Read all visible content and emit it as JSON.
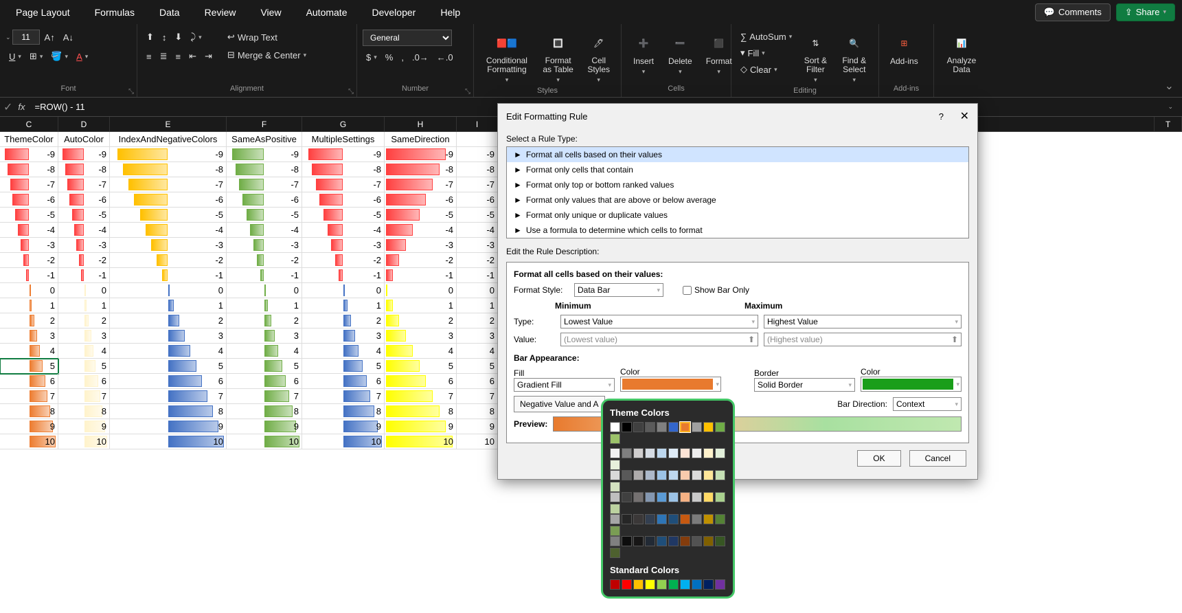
{
  "menu": {
    "items": [
      "Page Layout",
      "Formulas",
      "Data",
      "Review",
      "View",
      "Automate",
      "Developer",
      "Help"
    ],
    "comments": "Comments",
    "share": "Share"
  },
  "ribbon": {
    "font": {
      "label": "Font",
      "size": "11"
    },
    "alignment": {
      "label": "Alignment",
      "wrap": "Wrap Text",
      "merge": "Merge & Center"
    },
    "number": {
      "label": "Number",
      "format": "General"
    },
    "styles": {
      "label": "Styles",
      "conditional": "Conditional Formatting",
      "formatTable": "Format as Table",
      "cellStyles": "Cell Styles"
    },
    "cells": {
      "label": "Cells",
      "insert": "Insert",
      "delete": "Delete",
      "format": "Format"
    },
    "editing": {
      "label": "Editing",
      "autosum": "AutoSum",
      "fill": "Fill",
      "clear": "Clear",
      "sort": "Sort & Filter",
      "find": "Find & Select"
    },
    "addins": {
      "label": "Add-ins",
      "addins": "Add-ins"
    },
    "analyze": {
      "label": "",
      "analyze": "Analyze Data"
    }
  },
  "formula": {
    "fx": "fx",
    "value": "=ROW() - 11"
  },
  "grid": {
    "columns": [
      "C",
      "D",
      "E",
      "F",
      "G",
      "H",
      "I",
      "T"
    ],
    "headers": [
      "ThemeColor",
      "AutoColor",
      "IndexAndNegativeColors",
      "SameAsPositive",
      "MultipleSettings",
      "SameDirection",
      ""
    ],
    "values": [
      -9,
      -8,
      -7,
      -6,
      -5,
      -4,
      -3,
      -2,
      -1,
      0,
      1,
      2,
      3,
      4,
      5,
      6,
      7,
      8,
      9,
      10
    ],
    "selected_cell": "C5",
    "selected_value": 5
  },
  "dialog": {
    "title": "Edit Formatting Rule",
    "selectRuleLabel": "Select a Rule Type:",
    "rules": [
      "Format all cells based on their values",
      "Format only cells that contain",
      "Format only top or bottom ranked values",
      "Format only values that are above or below average",
      "Format only unique or duplicate values",
      "Use a formula to determine which cells to format"
    ],
    "editDescLabel": "Edit the Rule Description:",
    "formatHeader": "Format all cells based on their values:",
    "formatStyleLabel": "Format Style:",
    "formatStyle": "Data Bar",
    "showBarOnly": "Show Bar Only",
    "minimumLabel": "Minimum",
    "maximumLabel": "Maximum",
    "typeLabel": "Type:",
    "minType": "Lowest Value",
    "maxType": "Highest Value",
    "valueLabel": "Value:",
    "minValue": "(Lowest value)",
    "maxValue": "(Highest value)",
    "barAppearance": "Bar Appearance:",
    "fillLabel": "Fill",
    "fillValue": "Gradient Fill",
    "colorLabel": "Color",
    "fillColor": "#e87a2e",
    "borderLabel": "Border",
    "borderValue": "Solid Border",
    "borderColorLabel": "Color",
    "borderColor": "#1a9e1a",
    "negativeBtn": "Negative Value and A",
    "barDirLabel": "Bar Direction:",
    "barDirValue": "Context",
    "previewLabel": "Preview:",
    "ok": "OK",
    "cancel": "Cancel"
  },
  "colorPicker": {
    "themeTitle": "Theme Colors",
    "standardTitle": "Standard Colors",
    "themeColors": [
      [
        "#ffffff",
        "#000000",
        "#404040",
        "#5b5b5b",
        "#808080",
        "#3366cc",
        "#e87a2e",
        "#a0a0a0",
        "#ffc000",
        "#70ad47",
        "#9cc26a"
      ],
      [
        "#f2f2f2",
        "#7f7f7f",
        "#d0cece",
        "#d6dce4",
        "#bdd7ee",
        "#deebf6",
        "#fce4d6",
        "#ededed",
        "#fff2cc",
        "#e2efda",
        "#e7f0db"
      ],
      [
        "#d9d9d9",
        "#595959",
        "#aeabab",
        "#adb9ca",
        "#9cc3e6",
        "#bdd7ee",
        "#f8cbad",
        "#dbdbdb",
        "#ffe699",
        "#c5e0b4",
        "#d4e2c0"
      ],
      [
        "#bfbfbf",
        "#404040",
        "#757171",
        "#8497b0",
        "#5b9bd5",
        "#9cc3e6",
        "#f4b184",
        "#c9c9c9",
        "#ffd966",
        "#a9d18e",
        "#bcd2a0"
      ],
      [
        "#a6a6a6",
        "#262626",
        "#3b3838",
        "#333f50",
        "#2e75b6",
        "#1f4e79",
        "#c65911",
        "#7b7b7b",
        "#bf9000",
        "#548235",
        "#7a9d54"
      ],
      [
        "#808080",
        "#0d0d0d",
        "#171616",
        "#222a35",
        "#1f4e79",
        "#203864",
        "#843c0c",
        "#525252",
        "#806000",
        "#375623",
        "#4e612f"
      ]
    ],
    "standardColors": [
      "#c00000",
      "#ff0000",
      "#ffc000",
      "#ffff00",
      "#92d050",
      "#00b050",
      "#00b0f0",
      "#0070c0",
      "#002060",
      "#7030a0"
    ],
    "selected": "#e87a2e"
  },
  "chart_data": {
    "type": "table",
    "note": "Each column contains the same numeric series -9..10 rendered as conditional-format data bars with different color schemes.",
    "series_values": [
      -9,
      -8,
      -7,
      -6,
      -5,
      -4,
      -3,
      -2,
      -1,
      0,
      1,
      2,
      3,
      4,
      5,
      6,
      7,
      8,
      9,
      10
    ],
    "columns": [
      {
        "name": "ThemeColor",
        "negative_color": "#ff4040",
        "positive_color": "#ed7d31"
      },
      {
        "name": "AutoColor",
        "negative_color": "#ff4040",
        "positive_color": "#fff3cc"
      },
      {
        "name": "IndexAndNegativeColors",
        "negative_color": "#ffc000",
        "positive_color": "#4472c4"
      },
      {
        "name": "SameAsPositive",
        "negative_color": "#70ad47",
        "positive_color": "#70ad47"
      },
      {
        "name": "MultipleSettings",
        "negative_color": "#ff4040",
        "positive_color": "#4472c4"
      },
      {
        "name": "SameDirection",
        "negative_color": "#ff4040",
        "positive_color": "#ffff00"
      }
    ]
  }
}
